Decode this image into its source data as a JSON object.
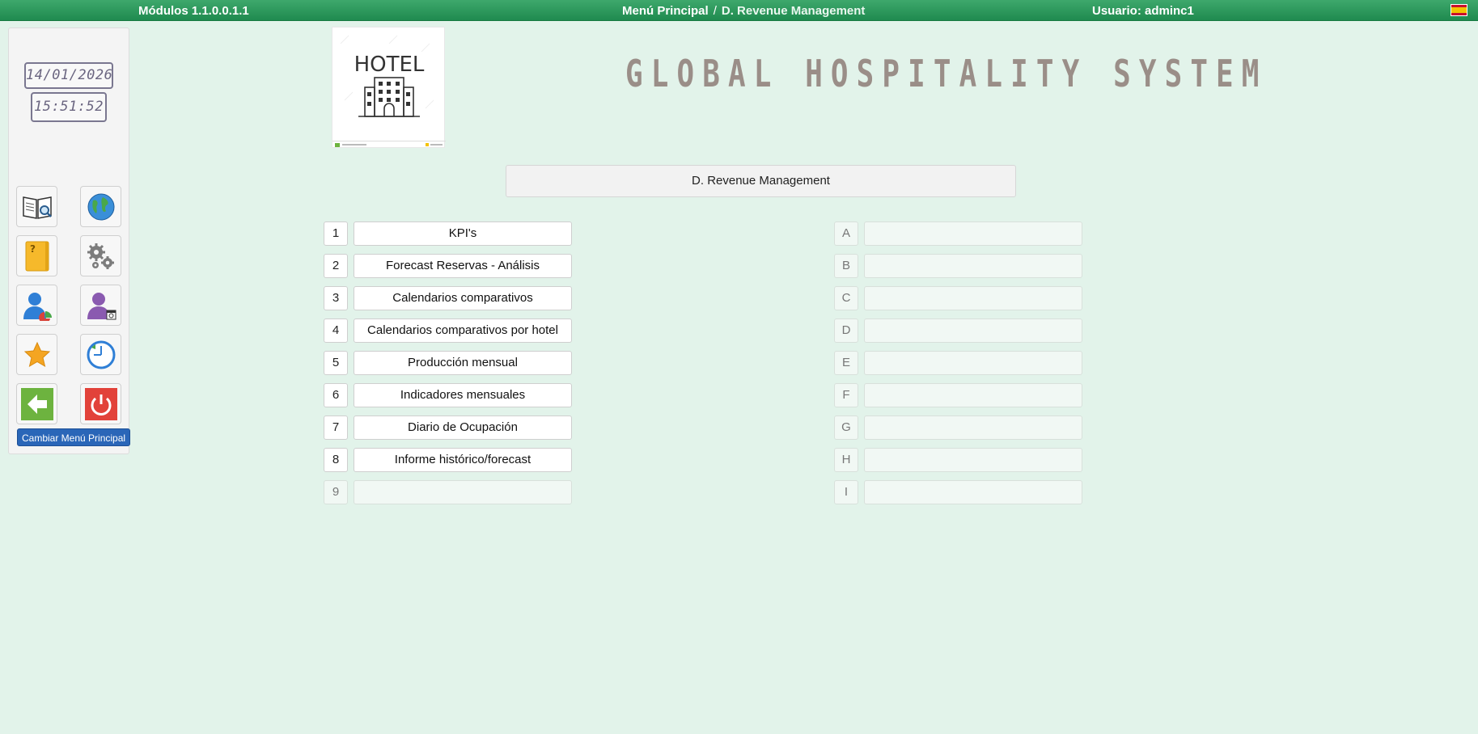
{
  "topbar": {
    "modules": "Módulos 1.1.0.0.1.1",
    "breadcrumb_root": "Menú Principal",
    "breadcrumb_sep": "/",
    "breadcrumb_current": "D. Revenue Management",
    "user": "Usuario: adminc1",
    "flag_icon": "spain-flag-icon"
  },
  "sidebar": {
    "date": "14/01/2026",
    "time": "15:51:52",
    "tooltip": "Cambiar Menú Principal",
    "icons": [
      "manual-icon",
      "globe-icon",
      "help-folder-icon",
      "settings-icon",
      "user-stats-icon",
      "user-info-icon",
      "favorites-star-icon",
      "history-clock-icon",
      "back-arrow-icon",
      "power-icon"
    ]
  },
  "header": {
    "title": "GLOBAL HOSPITALITY SYSTEM",
    "logo_text": "HOTEL"
  },
  "section": {
    "title": "D. Revenue Management"
  },
  "left_items": [
    {
      "key": "1",
      "label": "KPI's"
    },
    {
      "key": "2",
      "label": "Forecast Reservas - Análisis"
    },
    {
      "key": "3",
      "label": "Calendarios comparativos"
    },
    {
      "key": "4",
      "label": "Calendarios comparativos por hotel"
    },
    {
      "key": "5",
      "label": "Producción mensual"
    },
    {
      "key": "6",
      "label": "Indicadores mensuales"
    },
    {
      "key": "7",
      "label": "Diario de Ocupación"
    },
    {
      "key": "8",
      "label": "Informe histórico/forecast"
    },
    {
      "key": "9",
      "label": ""
    }
  ],
  "right_items": [
    {
      "key": "A",
      "label": ""
    },
    {
      "key": "B",
      "label": ""
    },
    {
      "key": "C",
      "label": ""
    },
    {
      "key": "D",
      "label": ""
    },
    {
      "key": "E",
      "label": ""
    },
    {
      "key": "F",
      "label": ""
    },
    {
      "key": "G",
      "label": ""
    },
    {
      "key": "H",
      "label": ""
    },
    {
      "key": "I",
      "label": ""
    }
  ],
  "colors": {
    "background": "#e2f3ea",
    "topbar": "#2b9a5c",
    "title": "#9a8e88",
    "tooltip": "#2a66b8"
  }
}
